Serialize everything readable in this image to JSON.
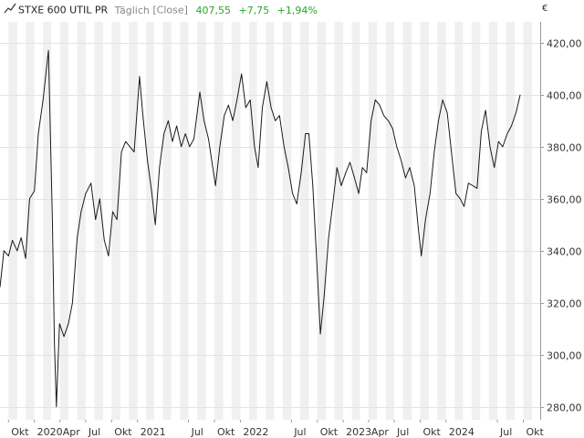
{
  "header": {
    "instrument": "STXE 600 UTIL PR",
    "interval": "Täglich",
    "mode": "[Close]",
    "last": "407,55",
    "change": "+7,75",
    "change_pct": "+1,94%"
  },
  "currency": "€",
  "colors": {
    "line": "#1a1a1a",
    "positive": "#2aa52a",
    "band": "#f0f0f0",
    "grid": "#e4e4e4",
    "axis": "#333333",
    "muted": "#777777"
  },
  "chart_data": {
    "type": "line",
    "xlabel": "",
    "ylabel": "",
    "xlim": [
      "2019-09-01",
      "2024-11-30"
    ],
    "ylim": [
      275,
      428
    ],
    "grid": true,
    "y_ticks": [
      {
        "value": 280,
        "label": "280,00"
      },
      {
        "value": 300,
        "label": "300,00"
      },
      {
        "value": 320,
        "label": "320,00"
      },
      {
        "value": 340,
        "label": "340,00"
      },
      {
        "value": 360,
        "label": "360,00"
      },
      {
        "value": 380,
        "label": "380,00"
      },
      {
        "value": 400,
        "label": "400,00"
      },
      {
        "value": 420,
        "label": "420,00"
      }
    ],
    "x_ticks": [
      {
        "date": "2019-10-01",
        "label": "Okt"
      },
      {
        "date": "2020-01-01",
        "label": "2020"
      },
      {
        "date": "2020-04-01",
        "label": "Apr"
      },
      {
        "date": "2020-07-01",
        "label": "Jul"
      },
      {
        "date": "2020-10-01",
        "label": "Okt"
      },
      {
        "date": "2021-01-01",
        "label": "2021"
      },
      {
        "date": "2021-07-01",
        "label": "Jul"
      },
      {
        "date": "2021-10-01",
        "label": "Okt"
      },
      {
        "date": "2022-01-01",
        "label": "2022"
      },
      {
        "date": "2022-07-01",
        "label": "Jul"
      },
      {
        "date": "2022-10-01",
        "label": "Okt"
      },
      {
        "date": "2023-01-01",
        "label": "2023"
      },
      {
        "date": "2023-04-01",
        "label": "Apr"
      },
      {
        "date": "2023-07-01",
        "label": "Jul"
      },
      {
        "date": "2023-10-01",
        "label": "Okt"
      },
      {
        "date": "2024-01-01",
        "label": "2024"
      },
      {
        "date": "2024-07-01",
        "label": "Jul"
      },
      {
        "date": "2024-10-01",
        "label": "Okt"
      }
    ],
    "series": [
      {
        "points": [
          [
            "2019-09-01",
            326
          ],
          [
            "2019-09-15",
            340
          ],
          [
            "2019-10-01",
            338
          ],
          [
            "2019-10-15",
            344
          ],
          [
            "2019-11-01",
            340
          ],
          [
            "2019-11-15",
            345
          ],
          [
            "2019-12-01",
            337
          ],
          [
            "2019-12-15",
            360
          ],
          [
            "2020-01-01",
            363
          ],
          [
            "2020-01-15",
            385
          ],
          [
            "2020-02-01",
            398
          ],
          [
            "2020-02-20",
            417
          ],
          [
            "2020-03-05",
            352
          ],
          [
            "2020-03-12",
            305
          ],
          [
            "2020-03-19",
            280
          ],
          [
            "2020-03-30",
            312
          ],
          [
            "2020-04-15",
            307
          ],
          [
            "2020-05-01",
            312
          ],
          [
            "2020-05-15",
            320
          ],
          [
            "2020-06-01",
            345
          ],
          [
            "2020-06-15",
            355
          ],
          [
            "2020-07-01",
            362
          ],
          [
            "2020-07-20",
            366
          ],
          [
            "2020-08-05",
            352
          ],
          [
            "2020-08-20",
            360
          ],
          [
            "2020-09-05",
            344
          ],
          [
            "2020-09-20",
            338
          ],
          [
            "2020-10-05",
            355
          ],
          [
            "2020-10-20",
            352
          ],
          [
            "2020-11-05",
            378
          ],
          [
            "2020-11-20",
            382
          ],
          [
            "2020-12-05",
            380
          ],
          [
            "2020-12-20",
            378
          ],
          [
            "2021-01-08",
            407
          ],
          [
            "2021-01-20",
            392
          ],
          [
            "2021-02-05",
            375
          ],
          [
            "2021-02-20",
            363
          ],
          [
            "2021-03-05",
            350
          ],
          [
            "2021-03-20",
            372
          ],
          [
            "2021-04-05",
            385
          ],
          [
            "2021-04-20",
            390
          ],
          [
            "2021-05-05",
            382
          ],
          [
            "2021-05-20",
            388
          ],
          [
            "2021-06-05",
            380
          ],
          [
            "2021-06-20",
            385
          ],
          [
            "2021-07-05",
            380
          ],
          [
            "2021-07-20",
            383
          ],
          [
            "2021-08-10",
            401
          ],
          [
            "2021-08-25",
            390
          ],
          [
            "2021-09-10",
            383
          ],
          [
            "2021-09-25",
            372
          ],
          [
            "2021-10-05",
            365
          ],
          [
            "2021-10-20",
            380
          ],
          [
            "2021-11-05",
            392
          ],
          [
            "2021-11-20",
            396
          ],
          [
            "2021-12-05",
            390
          ],
          [
            "2021-12-20",
            398
          ],
          [
            "2022-01-05",
            408
          ],
          [
            "2022-01-20",
            395
          ],
          [
            "2022-02-05",
            398
          ],
          [
            "2022-02-20",
            380
          ],
          [
            "2022-03-05",
            372
          ],
          [
            "2022-03-20",
            395
          ],
          [
            "2022-04-05",
            405
          ],
          [
            "2022-04-20",
            395
          ],
          [
            "2022-05-05",
            390
          ],
          [
            "2022-05-20",
            392
          ],
          [
            "2022-06-05",
            380
          ],
          [
            "2022-06-20",
            372
          ],
          [
            "2022-07-05",
            362
          ],
          [
            "2022-07-20",
            358
          ],
          [
            "2022-08-05",
            370
          ],
          [
            "2022-08-20",
            385
          ],
          [
            "2022-09-01",
            385
          ],
          [
            "2022-09-15",
            365
          ],
          [
            "2022-10-01",
            332
          ],
          [
            "2022-10-12",
            308
          ],
          [
            "2022-10-25",
            322
          ],
          [
            "2022-11-10",
            345
          ],
          [
            "2022-11-25",
            358
          ],
          [
            "2022-12-10",
            372
          ],
          [
            "2022-12-25",
            365
          ],
          [
            "2023-01-10",
            370
          ],
          [
            "2023-01-25",
            374
          ],
          [
            "2023-02-10",
            368
          ],
          [
            "2023-02-25",
            362
          ],
          [
            "2023-03-10",
            372
          ],
          [
            "2023-03-25",
            370
          ],
          [
            "2023-04-10",
            390
          ],
          [
            "2023-04-25",
            398
          ],
          [
            "2023-05-10",
            396
          ],
          [
            "2023-05-25",
            392
          ],
          [
            "2023-06-10",
            390
          ],
          [
            "2023-06-25",
            387
          ],
          [
            "2023-07-10",
            380
          ],
          [
            "2023-07-25",
            375
          ],
          [
            "2023-08-10",
            368
          ],
          [
            "2023-08-25",
            372
          ],
          [
            "2023-09-10",
            365
          ],
          [
            "2023-09-25",
            348
          ],
          [
            "2023-10-05",
            338
          ],
          [
            "2023-10-20",
            352
          ],
          [
            "2023-11-05",
            362
          ],
          [
            "2023-11-20",
            378
          ],
          [
            "2023-12-05",
            390
          ],
          [
            "2023-12-20",
            398
          ],
          [
            "2024-01-05",
            393
          ],
          [
            "2024-01-20",
            378
          ],
          [
            "2024-02-05",
            362
          ],
          [
            "2024-02-20",
            360
          ],
          [
            "2024-03-05",
            357
          ],
          [
            "2024-03-20",
            366
          ],
          [
            "2024-04-05",
            365
          ],
          [
            "2024-04-20",
            364
          ],
          [
            "2024-05-05",
            386
          ],
          [
            "2024-05-20",
            394
          ],
          [
            "2024-06-05",
            380
          ],
          [
            "2024-06-20",
            372
          ],
          [
            "2024-07-05",
            382
          ],
          [
            "2024-07-20",
            380
          ],
          [
            "2024-08-05",
            385
          ],
          [
            "2024-08-20",
            388
          ],
          [
            "2024-09-05",
            393
          ],
          [
            "2024-09-20",
            400
          ]
        ]
      }
    ]
  }
}
